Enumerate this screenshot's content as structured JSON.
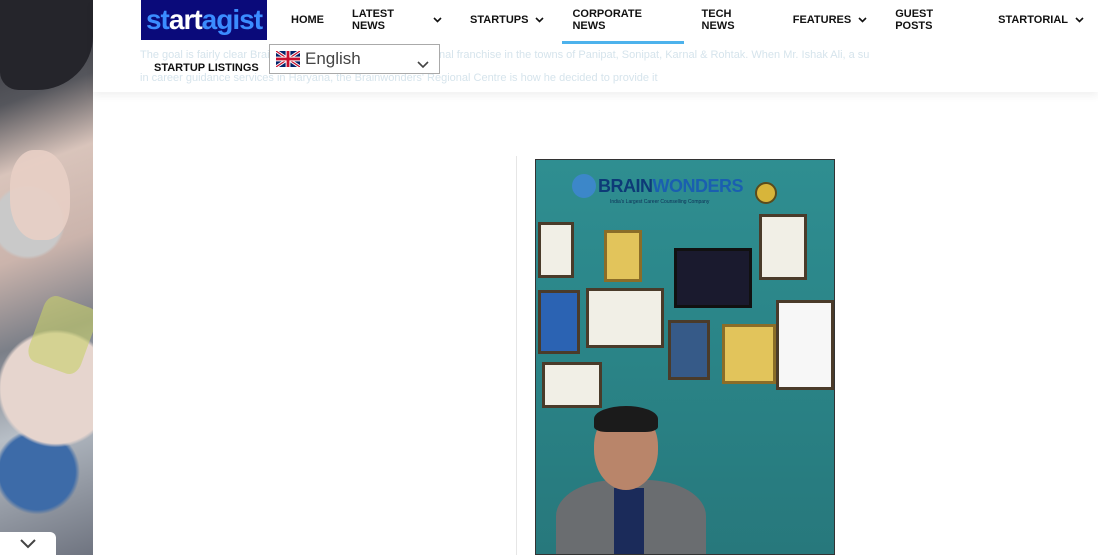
{
  "logo": {
    "part1": "st",
    "part2": "art",
    "part3": "agist"
  },
  "nav": {
    "items": [
      {
        "label": "HOME"
      },
      {
        "label": "LATEST NEWS"
      },
      {
        "label": "STARTUPS"
      },
      {
        "label": "CORPORATE NEWS"
      },
      {
        "label": "TECH NEWS"
      },
      {
        "label": "FEATURES"
      },
      {
        "label": "GUEST POSTS"
      },
      {
        "label": "STARTORIAL"
      }
    ],
    "row2_item": "STARTUP LISTINGS",
    "active": "CORPORATE NEWS"
  },
  "language": {
    "selected": "English"
  },
  "ghost": {
    "line1": "The goal is fairly clear  Brainwonders has arrived with its regional franchise in the towns of Panipat, Sonipat, Karnal & Rohtak. When Mr. Ishak Ali, a su",
    "line2": "in                                          career guidance services in Haryana, the Brainwonders' Regional Centre is how he decided to provide it"
  },
  "photo": {
    "brand_a": "BRAIN",
    "brand_b": "WONDERS",
    "tagline": "India's Largest Career Counselling Company"
  },
  "colors": {
    "accent": "#4db2ec",
    "logo_bg": "#0a0a7a",
    "nav_text": "#111111"
  },
  "icons": [
    "chevron-down-icon",
    "uk-flag-icon",
    "caret-down-icon"
  ]
}
